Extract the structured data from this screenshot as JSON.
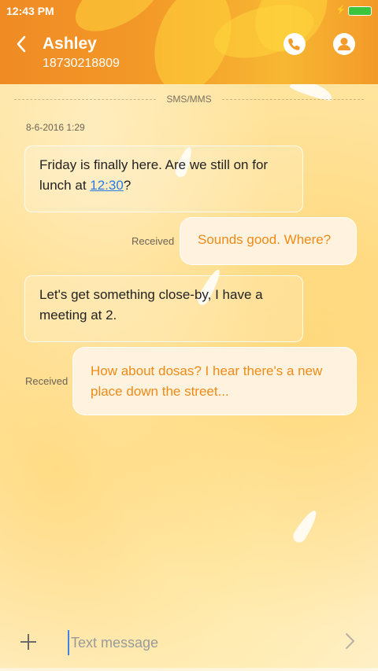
{
  "status_bar": {
    "time": "12:43 PM"
  },
  "header": {
    "contact_name": "Ashley",
    "contact_number": "18730218809"
  },
  "thread": {
    "channel_label": "SMS/MMS",
    "timestamp": "8-6-2016 1:29",
    "messages": [
      {
        "direction": "incoming",
        "text_before": "Friday is finally here. Are we still on for lunch at ",
        "link": "12:30",
        "text_after": "?"
      },
      {
        "direction": "outgoing",
        "status": "Received",
        "text": "Sounds good. Where?"
      },
      {
        "direction": "incoming",
        "text": "Let's get something close-by, I have a meeting at 2."
      },
      {
        "direction": "outgoing",
        "status": "Received",
        "text": "How about dosas? I hear there's a new place down the street..."
      }
    ]
  },
  "composer": {
    "placeholder": "Text message"
  },
  "colors": {
    "header": "#f39a28",
    "outgoing_text": "#f08a16",
    "link": "#2a7be4",
    "battery": "#3cc43c"
  },
  "icons": [
    "back-chevron-icon",
    "phone-icon",
    "person-icon",
    "plus-icon",
    "send-chevron-icon",
    "charging-icon",
    "battery-icon"
  ]
}
